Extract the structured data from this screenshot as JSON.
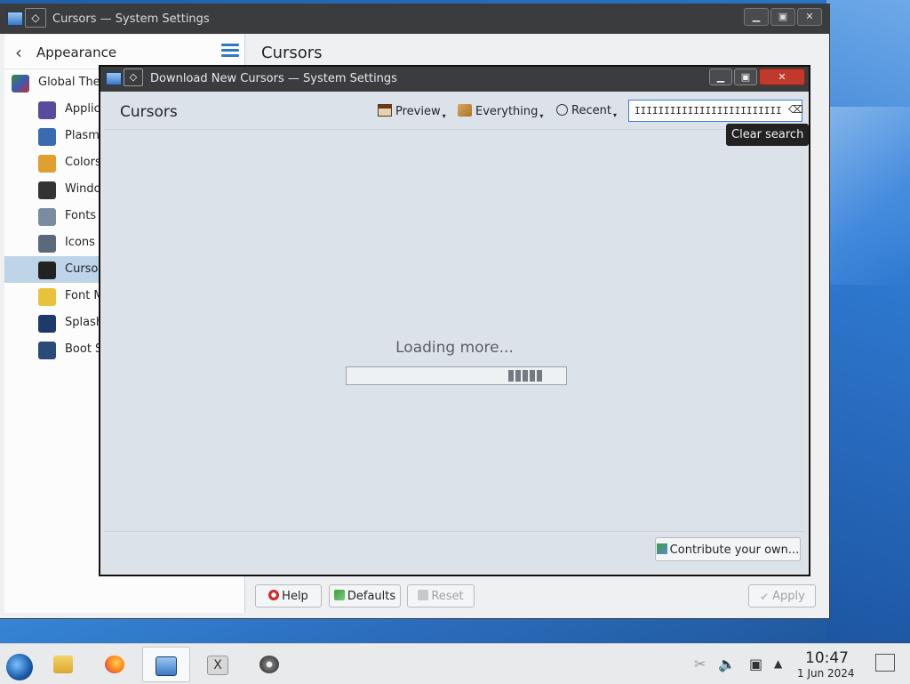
{
  "main_window": {
    "title": "Cursors — System Settings",
    "sidebar": {
      "back_label": "Appearance",
      "root_item": "Global The",
      "items": [
        {
          "label": "Applic",
          "icon": "application-style-icon",
          "color": "#5a4a9e"
        },
        {
          "label": "Plasm",
          "icon": "plasma-style-icon",
          "color": "#3a6ab0"
        },
        {
          "label": "Colors",
          "icon": "colors-icon",
          "color": "#e0a030"
        },
        {
          "label": "Windo",
          "icon": "window-decorations-icon",
          "color": "#333333"
        },
        {
          "label": "Fonts",
          "icon": "fonts-icon",
          "color": "#7a8ca0"
        },
        {
          "label": "Icons",
          "icon": "icons-icon",
          "color": "#5a6a7a"
        },
        {
          "label": "Curso",
          "icon": "cursor-icon",
          "color": "#222222",
          "selected": true
        },
        {
          "label": "Font M",
          "icon": "font-management-icon",
          "color": "#e8c23a"
        },
        {
          "label": "Splash",
          "icon": "splash-screen-icon",
          "color": "#1d3a6a"
        },
        {
          "label": "Boot S",
          "icon": "boot-splash-icon",
          "color": "#2a4a7a"
        }
      ]
    },
    "header_title": "Cursors",
    "buttons": {
      "help": "Help",
      "defaults": "Defaults",
      "reset": "Reset",
      "apply": "Apply"
    }
  },
  "dialog": {
    "title": "Download New Cursors — System Settings",
    "heading": "Cursors",
    "toolbar": {
      "preview": "Preview",
      "everything": "Everything",
      "recent": "Recent"
    },
    "search_value": "IIIIIIIIIIIIIIIIIIIIIIIII",
    "tooltip": "Clear search",
    "loading_text": "Loading more...",
    "contribute": "Contribute your own..."
  },
  "taskbar": {
    "time": "10:47",
    "date": "1 Jun 2024"
  },
  "colors": {
    "accent": "#3a7ed1",
    "selection": "#bed4e8",
    "titlebar": "#3b3c3d"
  }
}
